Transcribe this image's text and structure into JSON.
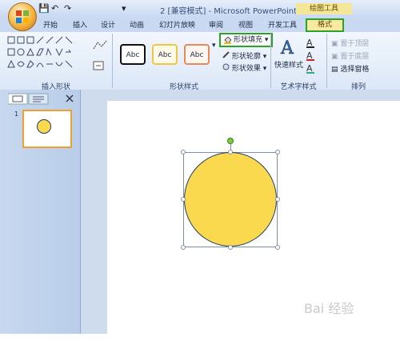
{
  "window": {
    "title": "2 [兼容模式] - Microsoft PowerPoint",
    "context_tool": "绘图工具"
  },
  "quick_access": {
    "save": "💾",
    "undo": "↶",
    "redo": "↷",
    "more": "▾"
  },
  "tabs": [
    "开始",
    "插入",
    "设计",
    "动画",
    "幻灯片放映",
    "审阅",
    "视图",
    "开发工具"
  ],
  "active_tab": "格式",
  "ribbon": {
    "groups": {
      "insert_shapes": "插入形状",
      "shape_styles": "形状样式",
      "wordart_styles": "艺术字样式",
      "arrange": "排列"
    },
    "style_samples": [
      "Abc",
      "Abc",
      "Abc"
    ],
    "shape_fill": "形状填充",
    "shape_outline": "形状轮廓",
    "shape_effects": "形状效果",
    "quick_styles": "快速样式",
    "bring_front": "置于顶层",
    "send_back": "置于底层",
    "selection_pane": "选择窗格",
    "dropdown": "▾"
  },
  "left_pane": {
    "slide_number": "1"
  },
  "watermark": "Bai 经验"
}
